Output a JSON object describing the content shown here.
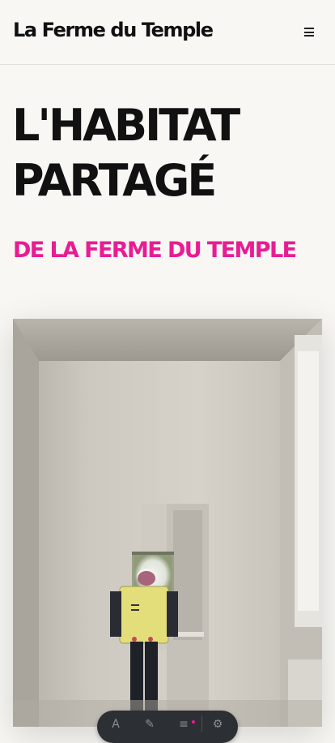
{
  "header": {
    "site_title": "La Ferme du Temple",
    "menu_icon": "hamburger-icon"
  },
  "hero": {
    "title_line1": "L'HABITAT",
    "title_line2": "PARTAGÉ",
    "subtitle": "DE LA FERME DU TEMPLE",
    "accent_color": "#e81c93"
  },
  "toolbar": {
    "icons": [
      "text-icon",
      "pen-icon",
      "lines-icon",
      "settings-icon"
    ]
  }
}
